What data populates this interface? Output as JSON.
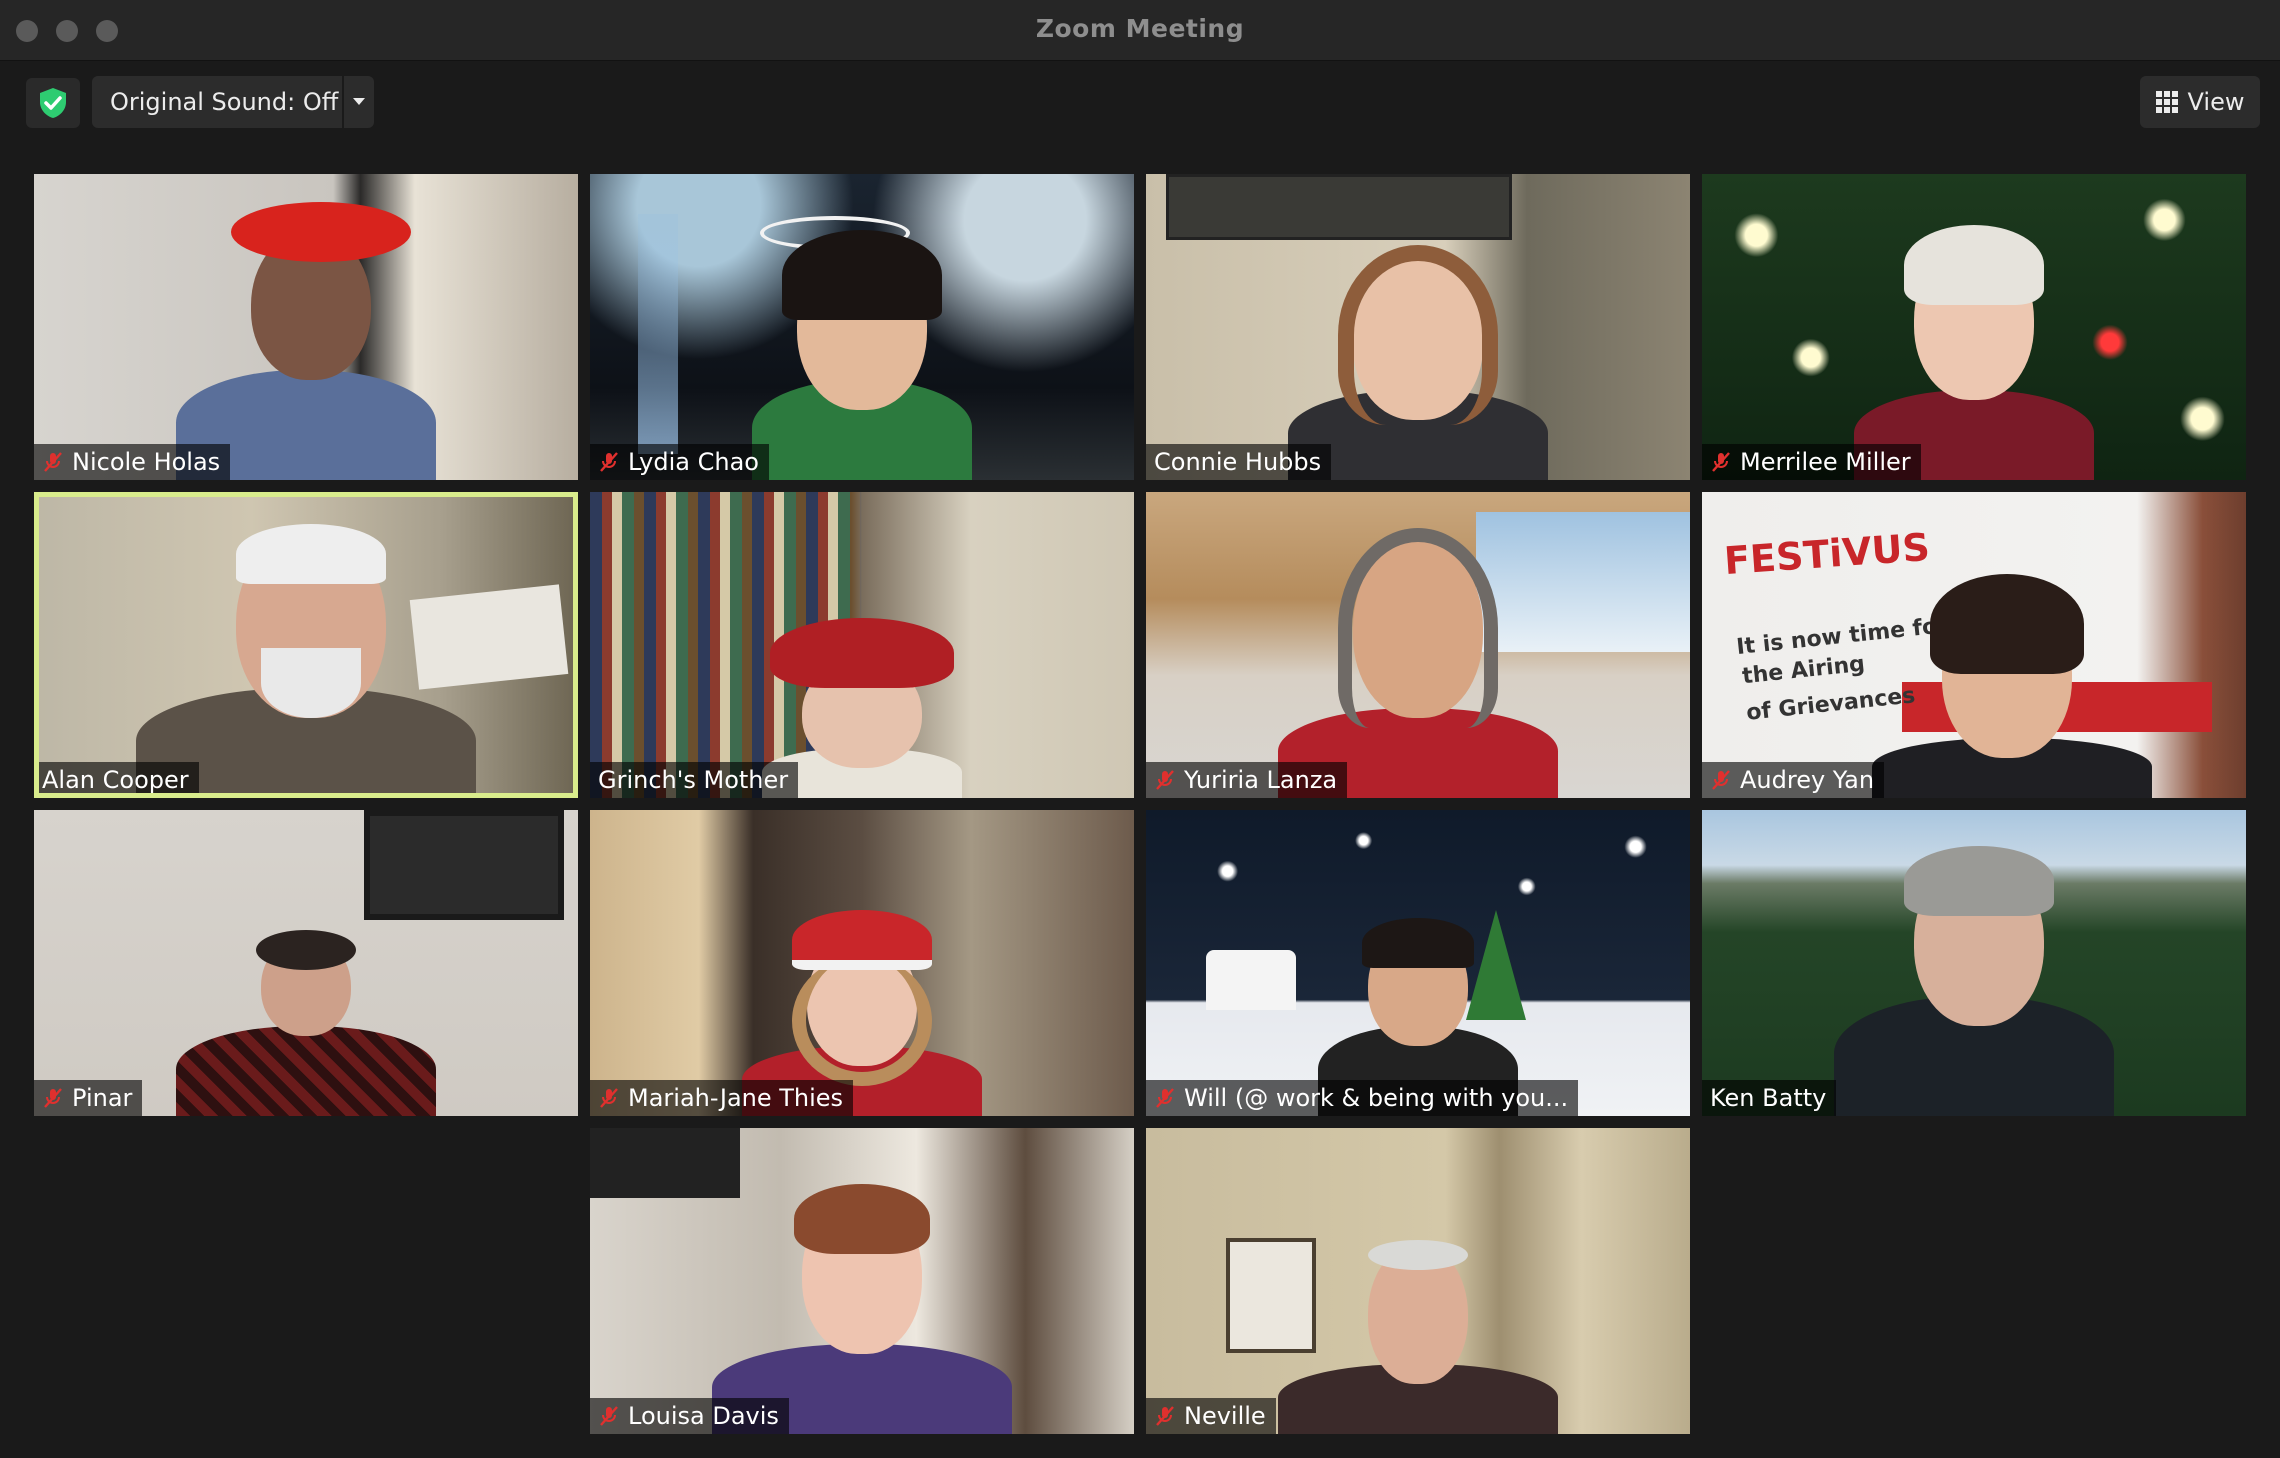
{
  "window": {
    "title": "Zoom Meeting"
  },
  "toolbar": {
    "original_sound_label": "Original Sound: Off",
    "view_label": "View"
  },
  "colors": {
    "active_speaker_border": "#d9ec8c",
    "muted_icon": "#e0302e",
    "shield": "#2ecc71"
  },
  "participants": [
    {
      "name": "Nicole Holas",
      "muted": true,
      "active": false
    },
    {
      "name": "Lydia Chao",
      "muted": true,
      "active": false
    },
    {
      "name": "Connie Hubbs",
      "muted": false,
      "active": false
    },
    {
      "name": "Merrilee Miller",
      "muted": true,
      "active": false
    },
    {
      "name": "Alan Cooper",
      "muted": false,
      "active": true
    },
    {
      "name": "Grinch's Mother",
      "muted": false,
      "active": false
    },
    {
      "name": "Yuriria Lanza",
      "muted": true,
      "active": false
    },
    {
      "name": "Audrey Yan",
      "muted": true,
      "active": false
    },
    {
      "name": "Pinar",
      "muted": true,
      "active": false
    },
    {
      "name": "Mariah-Jane Thies",
      "muted": true,
      "active": false
    },
    {
      "name": "Will (@ work & being with you...",
      "muted": true,
      "active": false
    },
    {
      "name": "Ken Batty",
      "muted": false,
      "active": false
    },
    {
      "name": "Louisa Davis",
      "muted": true,
      "active": false
    },
    {
      "name": "Neville",
      "muted": true,
      "active": false
    }
  ],
  "background_text": {
    "festivus_sign": "FESTiVUS",
    "festivus_lines": [
      "It is now time for",
      "the Airing",
      "of Grievances"
    ]
  }
}
